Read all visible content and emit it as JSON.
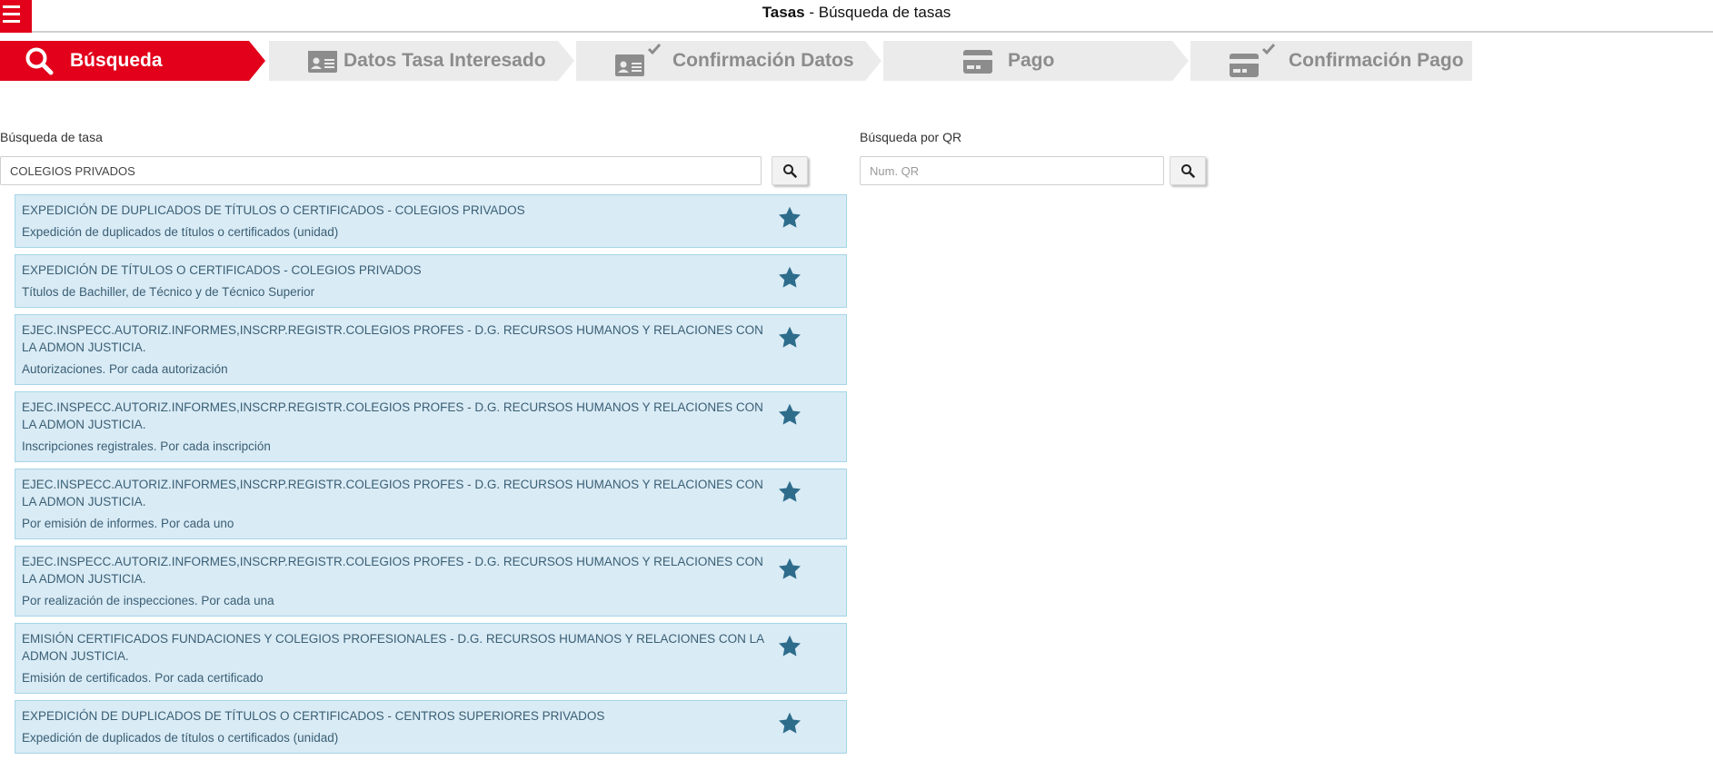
{
  "header": {
    "title_bold": "Tasas",
    "title_rest": " - Búsqueda de tasas"
  },
  "steps": [
    {
      "label": "Búsqueda",
      "icon": "search-icon",
      "active": true
    },
    {
      "label": "Datos Tasa Interesado",
      "icon": "id-card-icon",
      "active": false
    },
    {
      "label": "Confirmación Datos",
      "icon": "id-card-check-icon",
      "active": false
    },
    {
      "label": "Pago",
      "icon": "credit-card-icon",
      "active": false
    },
    {
      "label": "Confirmación Pago",
      "icon": "credit-card-check-icon",
      "active": false
    }
  ],
  "search": {
    "label": "Búsqueda de tasa",
    "value": "COLEGIOS PRIVADOS"
  },
  "qr": {
    "label": "Búsqueda por QR",
    "placeholder": "Num. QR",
    "value": ""
  },
  "results": [
    {
      "title": "EXPEDICIÓN DE DUPLICADOS DE TÍTULOS O CERTIFICADOS - COLEGIOS PRIVADOS",
      "desc": "Expedición de duplicados de títulos o certificados (unidad)"
    },
    {
      "title": "EXPEDICIÓN DE TÍTULOS O CERTIFICADOS - COLEGIOS PRIVADOS",
      "desc": "Títulos de Bachiller, de Técnico y de Técnico Superior"
    },
    {
      "title": "EJEC.INSPECC.AUTORIZ.INFORMES,INSCRP.REGISTR.COLEGIOS PROFES - D.G. RECURSOS HUMANOS Y RELACIONES CON LA ADMON JUSTICIA.",
      "desc": "Autorizaciones. Por cada autorización"
    },
    {
      "title": "EJEC.INSPECC.AUTORIZ.INFORMES,INSCRP.REGISTR.COLEGIOS PROFES - D.G. RECURSOS HUMANOS Y RELACIONES CON LA ADMON JUSTICIA.",
      "desc": "Inscripciones registrales. Por cada inscripción"
    },
    {
      "title": "EJEC.INSPECC.AUTORIZ.INFORMES,INSCRP.REGISTR.COLEGIOS PROFES - D.G. RECURSOS HUMANOS Y RELACIONES CON LA ADMON JUSTICIA.",
      "desc": "Por emisión de informes. Por cada uno"
    },
    {
      "title": "EJEC.INSPECC.AUTORIZ.INFORMES,INSCRP.REGISTR.COLEGIOS PROFES - D.G. RECURSOS HUMANOS Y RELACIONES CON LA ADMON JUSTICIA.",
      "desc": "Por realización de inspecciones. Por cada una"
    },
    {
      "title": "EMISIÓN CERTIFICADOS FUNDACIONES Y COLEGIOS PROFESIONALES - D.G. RECURSOS HUMANOS Y RELACIONES CON LA ADMON JUSTICIA.",
      "desc": "Emisión de certificados. Por cada certificado"
    },
    {
      "title": "EXPEDICIÓN DE DUPLICADOS DE TÍTULOS O CERTIFICADOS - CENTROS SUPERIORES PRIVADOS",
      "desc": "Expedición de duplicados de títulos o certificados (unidad)"
    }
  ],
  "colors": {
    "brand_red": "#e2001a",
    "step_inactive": "#ebebeb",
    "result_bg": "#d9ebf5",
    "result_border": "#a5d6e6",
    "star": "#2e6c8c"
  }
}
